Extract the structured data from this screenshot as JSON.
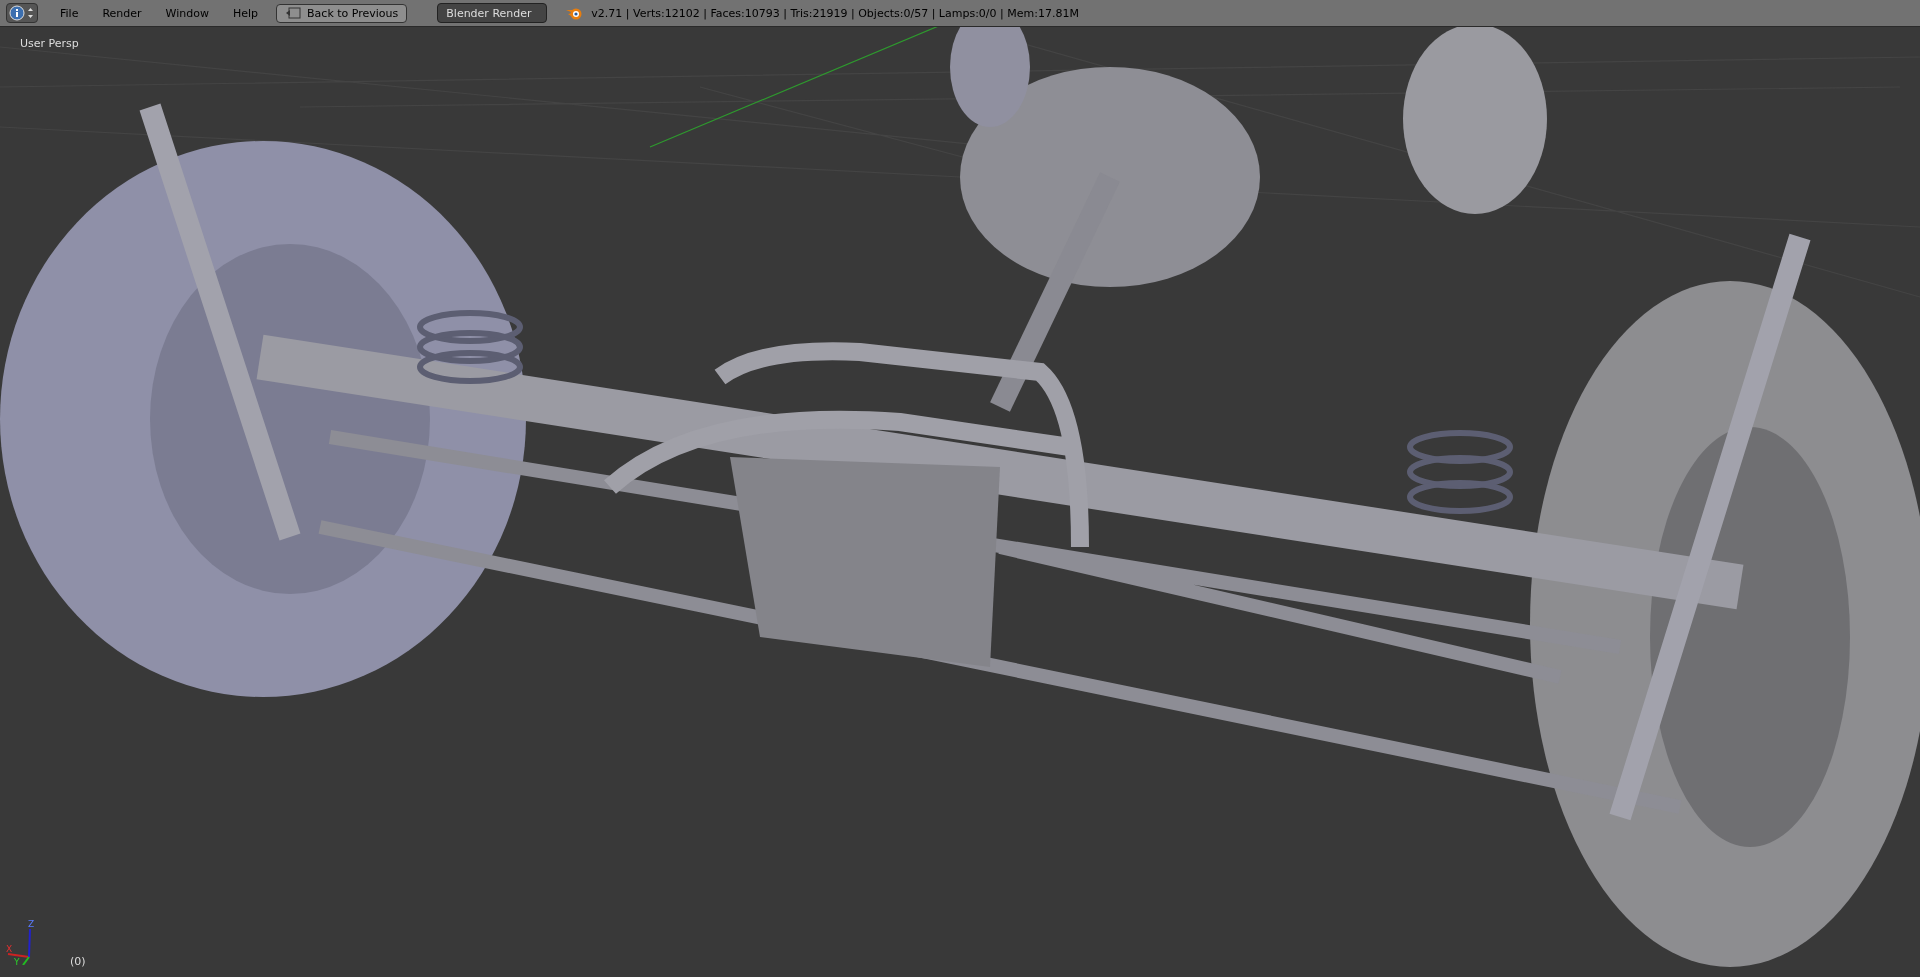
{
  "header": {
    "menus": [
      "File",
      "Render",
      "Window",
      "Help"
    ],
    "back_button": "Back to Previous",
    "render_engine": "Blender Render",
    "stats": "v2.71 | Verts:12102 | Faces:10793 | Tris:21919 | Objects:0/57 | Lamps:0/0 | Mem:17.81M"
  },
  "viewport": {
    "view_name": "User Persp",
    "frame": "(0)",
    "axes": [
      "X",
      "Y",
      "Z"
    ]
  }
}
